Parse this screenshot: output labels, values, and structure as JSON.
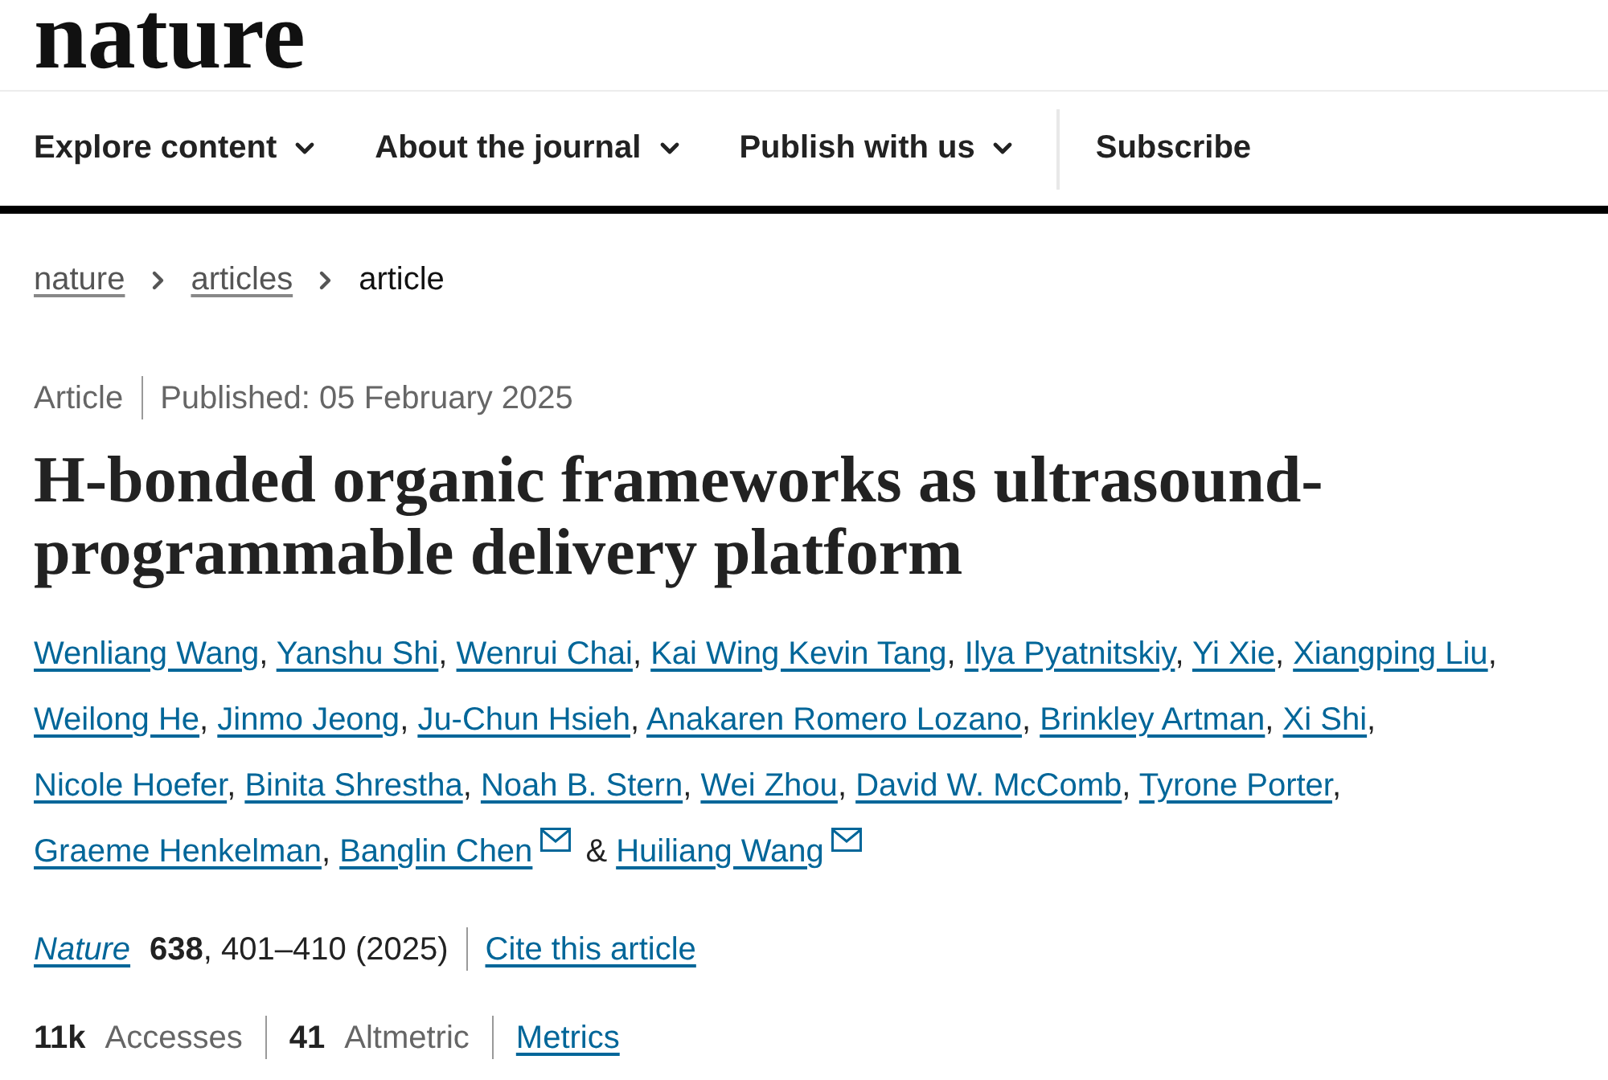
{
  "logo": {
    "text": "nature"
  },
  "nav": [
    {
      "label": "Explore content",
      "kind": "menu"
    },
    {
      "label": "About the journal",
      "kind": "menu"
    },
    {
      "label": "Publish with us",
      "kind": "menu"
    },
    {
      "label": "Subscribe",
      "kind": "link"
    }
  ],
  "breadcrumb": [
    {
      "label": "nature",
      "kind": "link"
    },
    {
      "label": "articles",
      "kind": "link"
    },
    {
      "label": "article",
      "kind": "current"
    }
  ],
  "article_meta": {
    "type": "Article",
    "published": "Published: 05 February 2025"
  },
  "title": "H-bonded organic frameworks as ultrasound-programmable delivery platform",
  "authors": [
    {
      "name": "Wenliang Wang",
      "separator": ",",
      "corresponding": false
    },
    {
      "name": "Yanshu Shi",
      "separator": ",",
      "corresponding": false
    },
    {
      "name": "Wenrui Chai",
      "separator": ",",
      "corresponding": false
    },
    {
      "name": "Kai Wing Kevin Tang",
      "separator": ",",
      "corresponding": false
    },
    {
      "name": "Ilya Pyatnitskiy",
      "separator": ",",
      "corresponding": false
    },
    {
      "name": "Yi Xie",
      "separator": ",",
      "corresponding": false
    },
    {
      "name": "Xiangping Liu",
      "separator": ",",
      "corresponding": false
    },
    {
      "name": "Weilong He",
      "separator": ",",
      "corresponding": false
    },
    {
      "name": "Jinmo Jeong",
      "separator": ",",
      "corresponding": false
    },
    {
      "name": "Ju-Chun Hsieh",
      "separator": ",",
      "corresponding": false
    },
    {
      "name": "Anakaren Romero Lozano",
      "separator": ",",
      "corresponding": false
    },
    {
      "name": "Brinkley Artman",
      "separator": ",",
      "corresponding": false
    },
    {
      "name": "Xi Shi",
      "separator": ",",
      "corresponding": false
    },
    {
      "name": "Nicole Hoefer",
      "separator": ",",
      "corresponding": false
    },
    {
      "name": "Binita Shrestha",
      "separator": ",",
      "corresponding": false
    },
    {
      "name": "Noah B. Stern",
      "separator": ",",
      "corresponding": false
    },
    {
      "name": "Wei Zhou",
      "separator": ",",
      "corresponding": false
    },
    {
      "name": "David W. McComb",
      "separator": ",",
      "corresponding": false
    },
    {
      "name": "Tyrone Porter",
      "separator": ",",
      "corresponding": false
    },
    {
      "name": "Graeme Henkelman",
      "separator": ",",
      "corresponding": false
    },
    {
      "name": "Banglin Chen",
      "separator": "&",
      "corresponding": true
    },
    {
      "name": "Huiliang Wang",
      "corresponding": true
    }
  ],
  "citation": {
    "journal": "Nature",
    "details": "**638**, 401–410 (2025)",
    "cite_link": "Cite this article"
  },
  "metrics": [
    {
      "kind": "stat",
      "count": "11k",
      "name": "Accesses"
    },
    {
      "kind": "stat",
      "count": "41",
      "name": "Altmetric"
    },
    {
      "kind": "link",
      "text": "Metrics"
    }
  ]
}
